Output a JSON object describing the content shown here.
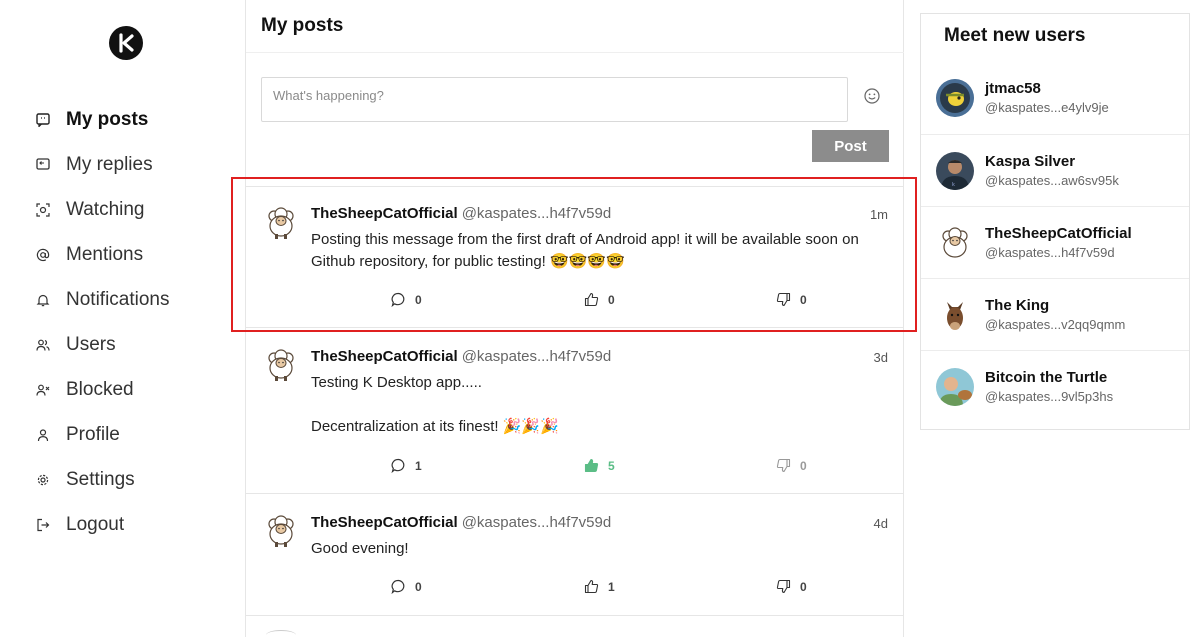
{
  "sidebar": {
    "items": [
      {
        "label": "My posts",
        "icon": "chat-square-icon",
        "active": true
      },
      {
        "label": "My replies",
        "icon": "reply-icon"
      },
      {
        "label": "Watching",
        "icon": "eye-scan-icon"
      },
      {
        "label": "Mentions",
        "icon": "at-icon"
      },
      {
        "label": "Notifications",
        "icon": "bell-icon"
      },
      {
        "label": "Users",
        "icon": "users-icon"
      },
      {
        "label": "Blocked",
        "icon": "user-x-icon"
      },
      {
        "label": "Profile",
        "icon": "user-icon"
      },
      {
        "label": "Settings",
        "icon": "gear-icon"
      },
      {
        "label": "Logout",
        "icon": "logout-icon"
      }
    ]
  },
  "main": {
    "title": "My posts",
    "compose_placeholder": "What's happening?",
    "post_button": "Post",
    "posts": [
      {
        "author": "TheSheepCatOfficial",
        "handle": "@kaspates...h4f7v59d",
        "time": "1m",
        "text": "Posting this message from the first draft of Android app! it will be available soon on Github repository, for public testing!  🤓🤓🤓🤓",
        "replies": "0",
        "likes": "0",
        "dislikes": "0"
      },
      {
        "author": "TheSheepCatOfficial",
        "handle": "@kaspates...h4f7v59d",
        "time": "3d",
        "text": "Testing K Desktop app.....\n\nDecentralization at its finest! 🎉🎉🎉",
        "replies": "1",
        "likes": "5",
        "dislikes": "0"
      },
      {
        "author": "TheSheepCatOfficial",
        "handle": "@kaspates...h4f7v59d",
        "time": "4d",
        "text": "Good evening!",
        "replies": "0",
        "likes": "1",
        "dislikes": "0"
      }
    ]
  },
  "right": {
    "title": "Meet new users",
    "users": [
      {
        "name": "jtmac58",
        "handle": "@kaspates...e4ylv9je"
      },
      {
        "name": "Kaspa Silver",
        "handle": "@kaspates...aw6sv95k"
      },
      {
        "name": "TheSheepCatOfficial",
        "handle": "@kaspates...h4f7v59d"
      },
      {
        "name": "The King",
        "handle": "@kaspates...v2qq9qmm"
      },
      {
        "name": "Bitcoin the Turtle",
        "handle": "@kaspates...9vl5p3hs"
      }
    ]
  },
  "colors": {
    "liked": "#5bbd86",
    "post_button": "#8c8c8c",
    "highlight": "#e02020"
  }
}
